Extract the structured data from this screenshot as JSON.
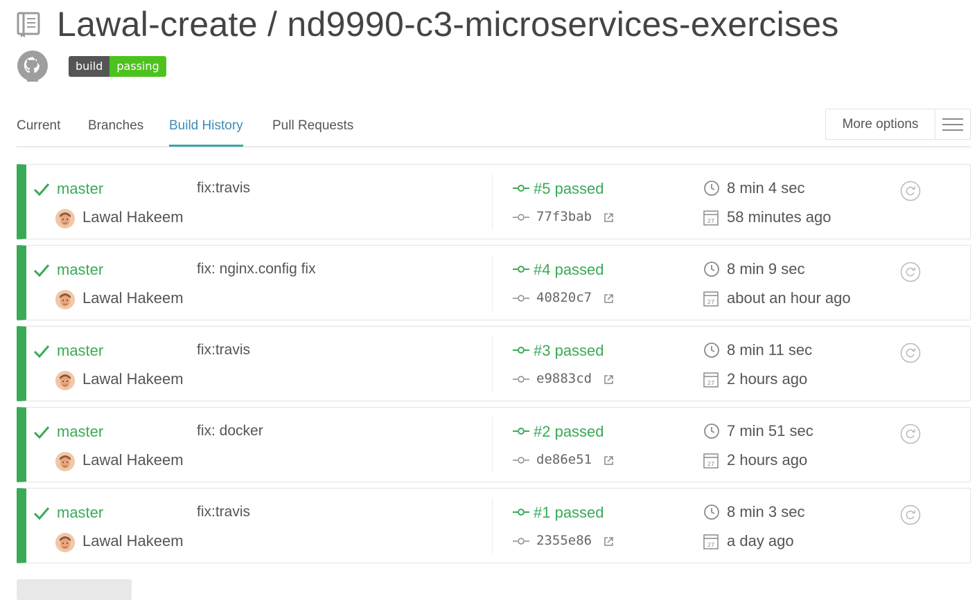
{
  "repo": {
    "title": "Lawal-create / nd9990-c3-microservices-exercises",
    "badge_left": "build",
    "badge_right": "passing"
  },
  "tabs": [
    {
      "label": "Current"
    },
    {
      "label": "Branches"
    },
    {
      "label": "Build History",
      "active": true
    },
    {
      "label": "Pull Requests"
    }
  ],
  "more_options": {
    "label": "More options"
  },
  "colors": {
    "passed": "#39aa56",
    "active_tab": "#3b8bba",
    "badge_passing": "#4dc21f"
  },
  "builds": [
    {
      "branch": "master",
      "author": "Lawal Hakeem",
      "message": "fix:travis",
      "number": "#5 passed",
      "sha": "77f3bab",
      "duration": "8 min 4 sec",
      "finished": "58 minutes ago"
    },
    {
      "branch": "master",
      "author": "Lawal Hakeem",
      "message": "fix: nginx.config fix",
      "number": "#4 passed",
      "sha": "40820c7",
      "duration": "8 min 9 sec",
      "finished": "about an hour ago"
    },
    {
      "branch": "master",
      "author": "Lawal Hakeem",
      "message": "fix:travis",
      "number": "#3 passed",
      "sha": "e9883cd",
      "duration": "8 min 11 sec",
      "finished": "2 hours ago"
    },
    {
      "branch": "master",
      "author": "Lawal Hakeem",
      "message": "fix: docker",
      "number": "#2 passed",
      "sha": "de86e51",
      "duration": "7 min 51 sec",
      "finished": "2 hours ago"
    },
    {
      "branch": "master",
      "author": "Lawal Hakeem",
      "message": "fix:travis",
      "number": "#1 passed",
      "sha": "2355e86",
      "duration": "8 min 3 sec",
      "finished": "a day ago"
    }
  ],
  "icons": {
    "repo": "repo-book-icon",
    "github": "github-icon",
    "status": "check-icon",
    "commit": "commit-icon",
    "external": "external-link-icon",
    "duration": "clock-icon",
    "finished": "calendar-icon",
    "restart": "restart-icon"
  }
}
